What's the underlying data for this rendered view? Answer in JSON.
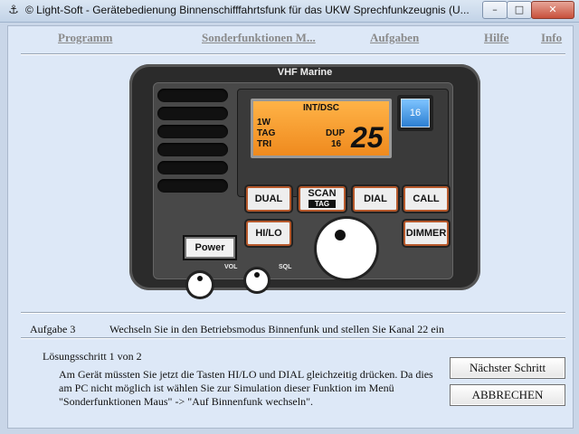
{
  "window": {
    "title": "© Light-Soft  -  Gerätebedienung Binnenschifffahrtsfunk für das UKW Sprechfunkzeugnis (U...",
    "min_symbol": "–",
    "max_symbol": "□",
    "close_symbol": "✕"
  },
  "menu": [
    "Programm",
    "Sonderfunktionen M...",
    "Aufgaben",
    "Hilfe",
    "Info"
  ],
  "radio": {
    "title": "VHF Marine",
    "display": {
      "mode": "INT/DSC",
      "power": "1W",
      "day": "TAG",
      "watch": "TRI",
      "dup": "DUP",
      "sub": "16",
      "channel": "25"
    },
    "ch16_button": "16",
    "buttons": {
      "dual": "DUAL",
      "scan": "SCAN",
      "scan_sub": "TAG",
      "dial": "DIAL",
      "call": "CALL",
      "hilo": "HI/LO",
      "dimmer": "DIMMER"
    },
    "power_button": "Power",
    "vol_label": "VOL",
    "sql_label": "SQL"
  },
  "task": {
    "label": "Aufgabe 3",
    "text": "Wechseln Sie in den Betriebsmodus Binnenfunk und stellen Sie Kanal 22 ein"
  },
  "solution": {
    "step": "Lösungsschritt 1 von 2",
    "line1": "Am Gerät müssten Sie jetzt die Tasten HI/LO und DIAL gleichzeitig drücken. Da dies",
    "line2": "am PC nicht möglich ist wählen Sie zur Simulation dieser Funktion im Menü",
    "line3": "\"Sonderfunktionen Maus\" -> \"Auf Binnenfunk wechseln\"."
  },
  "actions": {
    "next": "Nächster Schritt",
    "cancel": "ABBRECHEN"
  },
  "colors": {
    "lcd": "#ef8a1e",
    "button_border": "#b6592c",
    "ch16": "#2c7fd2",
    "window_bg": "#dde8f7"
  }
}
